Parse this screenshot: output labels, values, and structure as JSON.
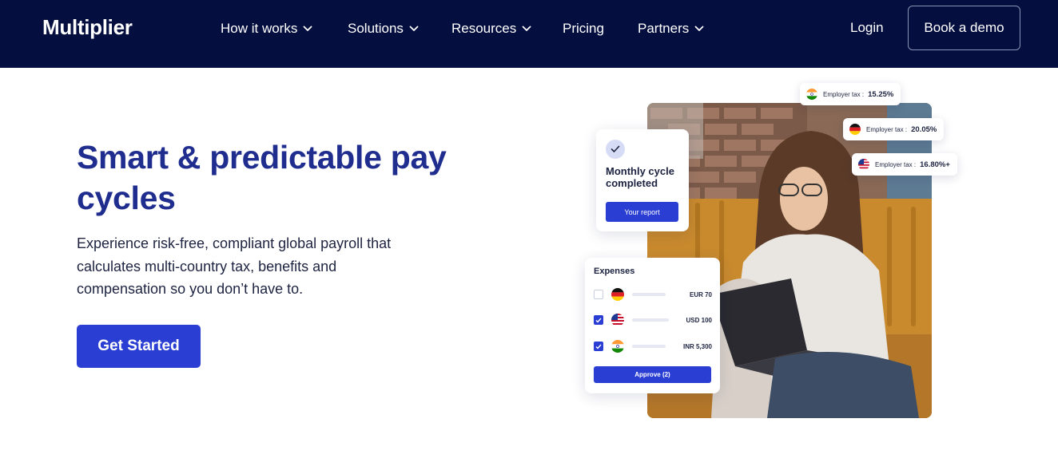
{
  "nav": {
    "logo": "Multiplier",
    "items": [
      {
        "label": "How it works",
        "dropdown": true
      },
      {
        "label": "Solutions",
        "dropdown": true
      },
      {
        "label": "Resources",
        "dropdown": true
      },
      {
        "label": "Pricing",
        "dropdown": false
      },
      {
        "label": "Partners",
        "dropdown": true
      }
    ],
    "login": "Login",
    "demo": "Book a demo"
  },
  "hero": {
    "title": "Smart & predictable pay cycles",
    "subtitle": "Experience risk-free, compliant global payroll that calculates multi-country tax, benefits and compensation so you don’t have to.",
    "cta": "Get Started"
  },
  "cycle_card": {
    "title": "Monthly cycle completed",
    "button": "Your report"
  },
  "expenses": {
    "title": "Expenses",
    "rows": [
      {
        "flag": "germany-flag-icon",
        "checked": false,
        "amount": "EUR 70"
      },
      {
        "flag": "usa-flag-icon",
        "checked": true,
        "amount": "USD 100"
      },
      {
        "flag": "india-flag-icon",
        "checked": true,
        "amount": "INR 5,300"
      }
    ],
    "approve": "Approve (2)"
  },
  "taxes": [
    {
      "flag": "india-flag-icon",
      "label": "Employer tax :",
      "value": "15.25%"
    },
    {
      "flag": "germany-flag-icon",
      "label": "Employer tax :",
      "value": "20.05%"
    },
    {
      "flag": "usa-flag-icon",
      "label": "Employer tax :",
      "value": "16.80%+"
    }
  ],
  "colors": {
    "nav_bg": "#050f3f",
    "accent": "#2a3ed3",
    "title": "#1f2d8f"
  }
}
